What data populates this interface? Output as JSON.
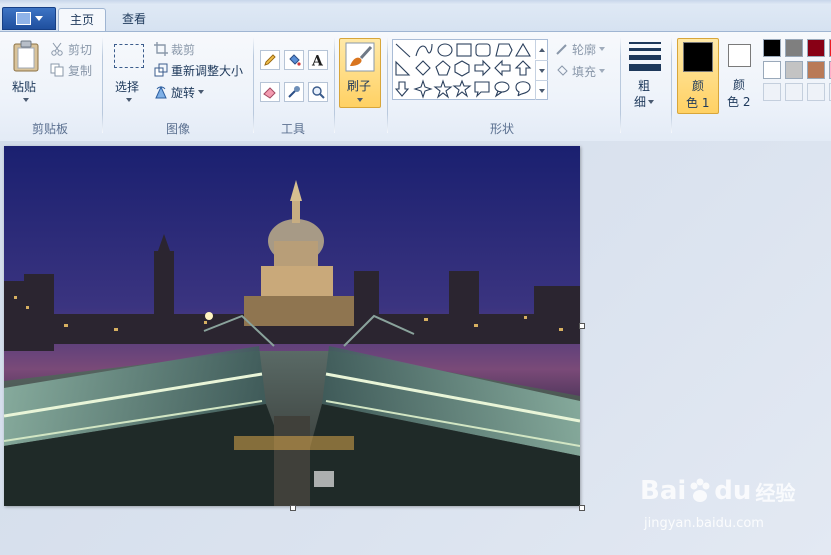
{
  "tabs": {
    "home": "主页",
    "view": "查看"
  },
  "clipboard": {
    "paste": "粘贴",
    "cut": "剪切",
    "copy": "复制",
    "group": "剪贴板"
  },
  "image": {
    "select": "选择",
    "crop": "裁剪",
    "resize": "重新调整大小",
    "rotate": "旋转",
    "group": "图像"
  },
  "tools": {
    "group": "工具"
  },
  "brushes": {
    "label": "刷子"
  },
  "shapes": {
    "outline": "轮廓",
    "fill": "填充",
    "group": "形状"
  },
  "size": {
    "line1": "粗",
    "line2": "细"
  },
  "colors": {
    "color1_line1": "颜",
    "color1_line2": "色 1",
    "color2_line1": "颜",
    "color2_line2": "色 2",
    "color1_value": "#000000",
    "color2_value": "#ffffff",
    "palette_row1": [
      "#000000",
      "#7f7f7f",
      "#880015",
      "#ed1c24"
    ],
    "palette_row2": [
      "#ffffff",
      "#c3c3c3",
      "#b97a57",
      "#ffaec9"
    ]
  },
  "watermark": {
    "brand_left": "Bai",
    "brand_right": "du",
    "brand_suffix": "经验",
    "url": "jingyan.baidu.com"
  }
}
